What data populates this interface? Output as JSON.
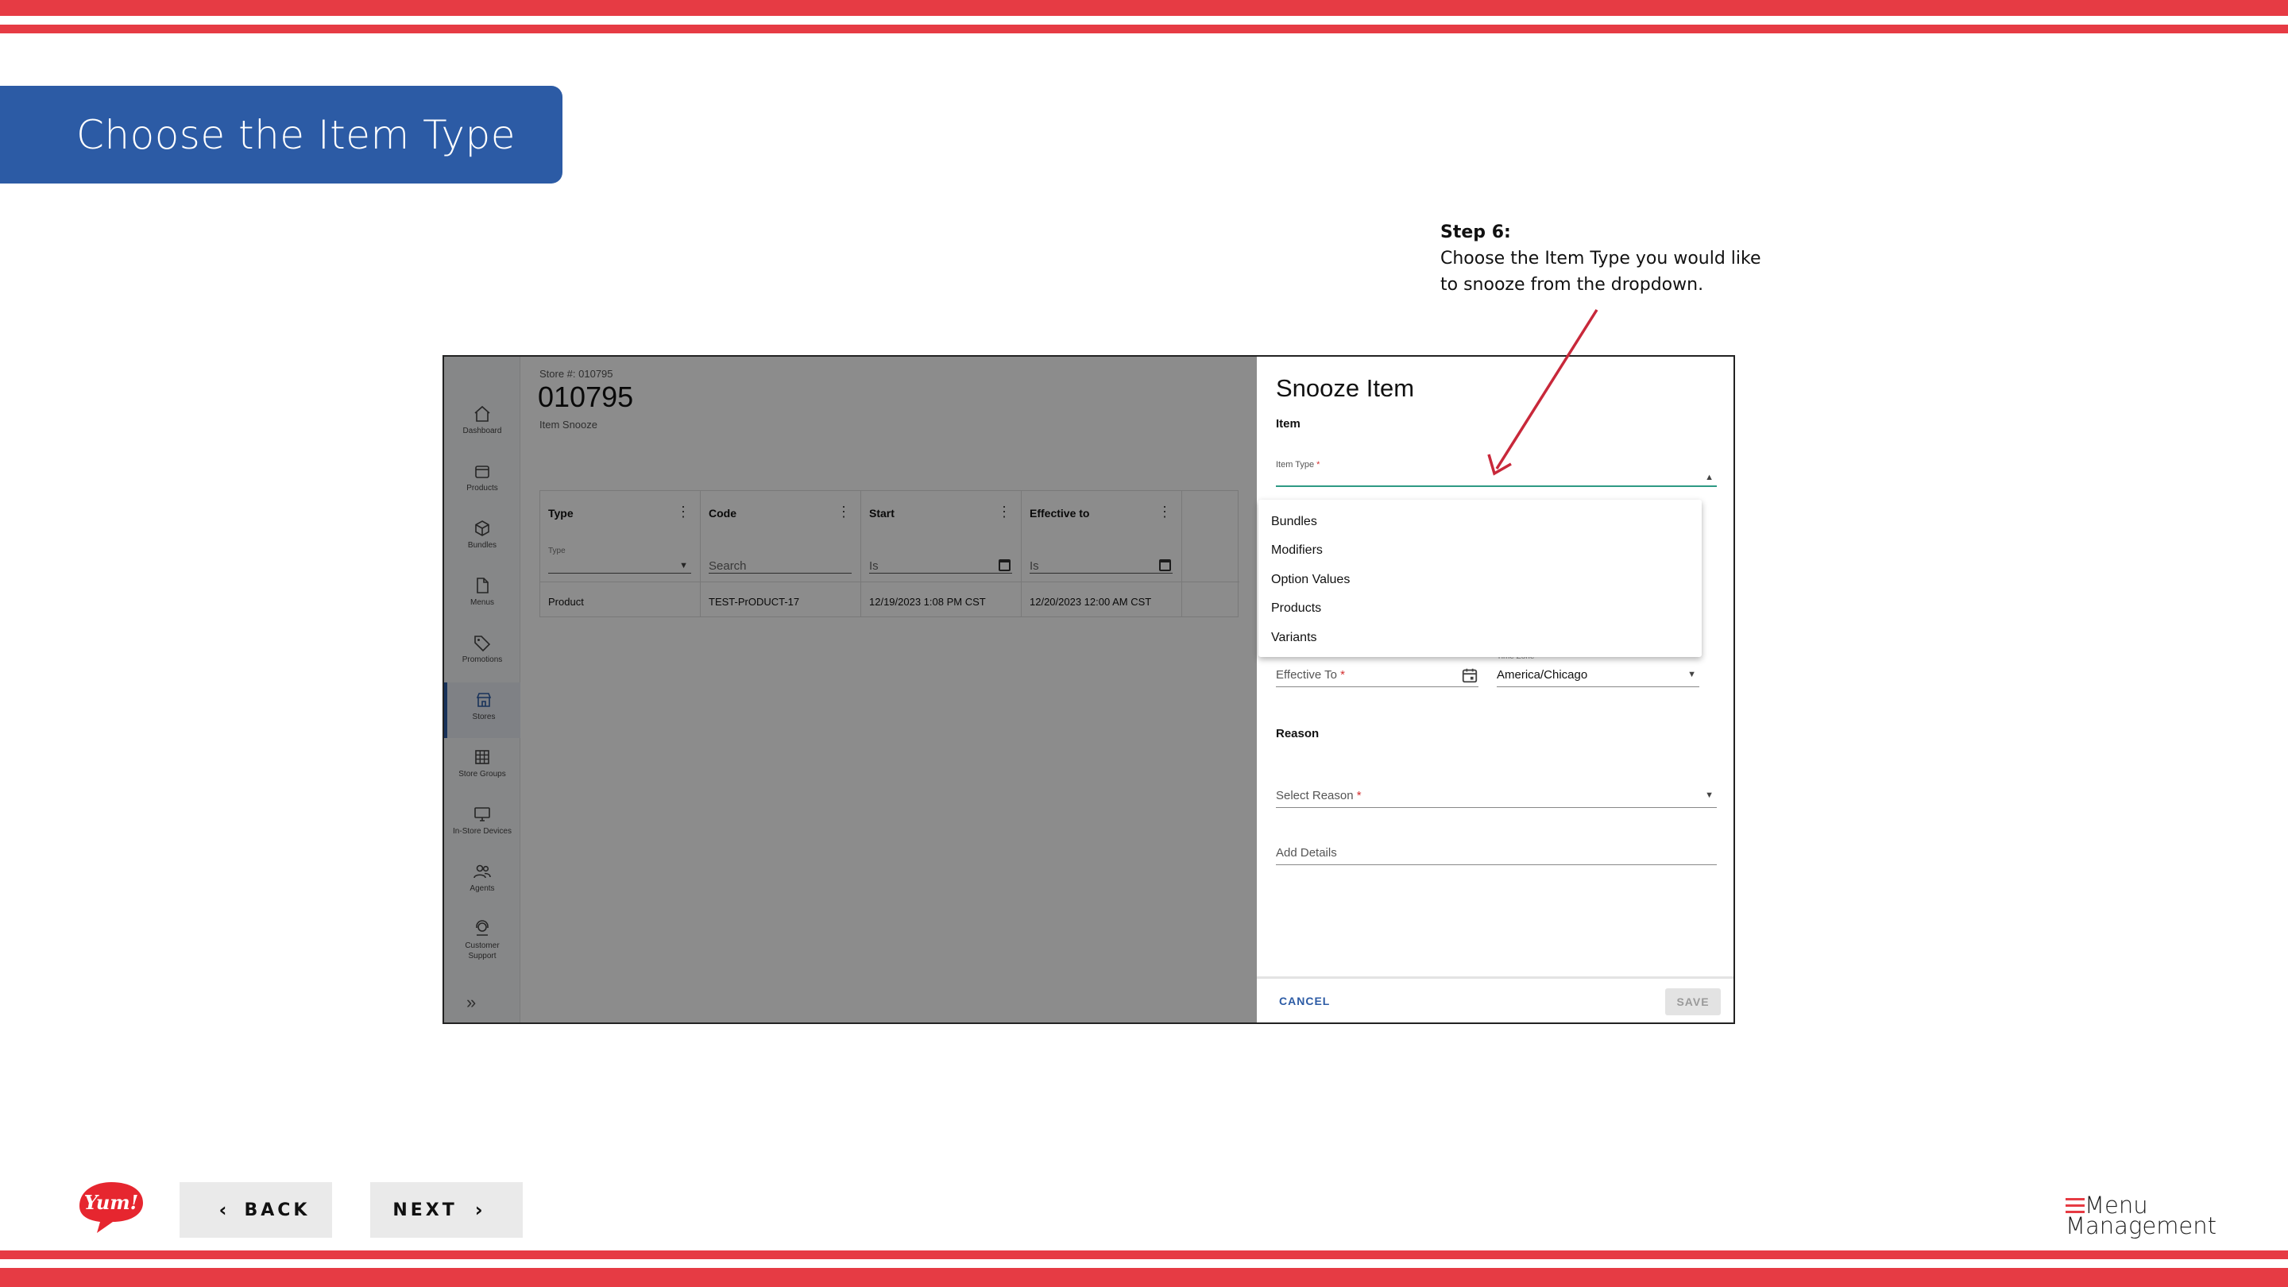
{
  "slide": {
    "title": "Choose the Item Type",
    "step_label": "Step 6:",
    "step_text": "Choose the Item Type you would like to snooze from the dropdown.",
    "back_label": "BACK",
    "next_label": "NEXT",
    "logo_left_text": "Yum!",
    "logo_right_line1": "Menu",
    "logo_right_line2": "Management",
    "colors": {
      "stripe": "#e63b44",
      "banner": "#2c5ba5",
      "link": "#2c5ba5"
    }
  },
  "sidebar": {
    "items": [
      {
        "label": "Dashboard",
        "icon": "home-icon"
      },
      {
        "label": "Products",
        "icon": "box-icon"
      },
      {
        "label": "Bundles",
        "icon": "cube-icon"
      },
      {
        "label": "Menus",
        "icon": "document-icon"
      },
      {
        "label": "Promotions",
        "icon": "tag-icon"
      },
      {
        "label": "Stores",
        "icon": "store-icon",
        "active": true
      },
      {
        "label": "Store Groups",
        "icon": "grid-icon"
      },
      {
        "label": "In-Store Devices",
        "icon": "monitor-icon"
      },
      {
        "label": "Agents",
        "icon": "people-icon"
      },
      {
        "label": "Customer Support",
        "icon": "support-icon"
      }
    ],
    "expand_icon": "double-chevron-right-icon"
  },
  "store": {
    "subtitle": "Store #: 010795",
    "number": "010795",
    "page_label": "Item Snooze"
  },
  "table": {
    "columns": [
      "Type",
      "Code",
      "Start",
      "Effective to"
    ],
    "filters": [
      {
        "label": "Type",
        "value": ""
      },
      {
        "label": "",
        "value": "Search"
      },
      {
        "label": "",
        "value": "Is"
      },
      {
        "label": "",
        "value": "Is"
      }
    ],
    "rows": [
      [
        "Product",
        "TEST-PrODUCT-17",
        "12/19/2023 1:08 PM CST",
        "12/20/2023 12:00 AM CST"
      ]
    ]
  },
  "panel": {
    "title": "Snooze Item",
    "item_section": "Item",
    "item_type_label": "Item Type",
    "dropdown_options": [
      "Bundles",
      "Modifiers",
      "Option Values",
      "Products",
      "Variants"
    ],
    "effective_to_label": "Effective To",
    "time_zone_label": "Time Zone",
    "time_zone_value": "America/Chicago",
    "reason_section": "Reason",
    "select_reason_label": "Select Reason",
    "add_details_label": "Add Details",
    "required_mark": "*",
    "cancel_label": "CANCEL",
    "save_label": "SAVE"
  }
}
